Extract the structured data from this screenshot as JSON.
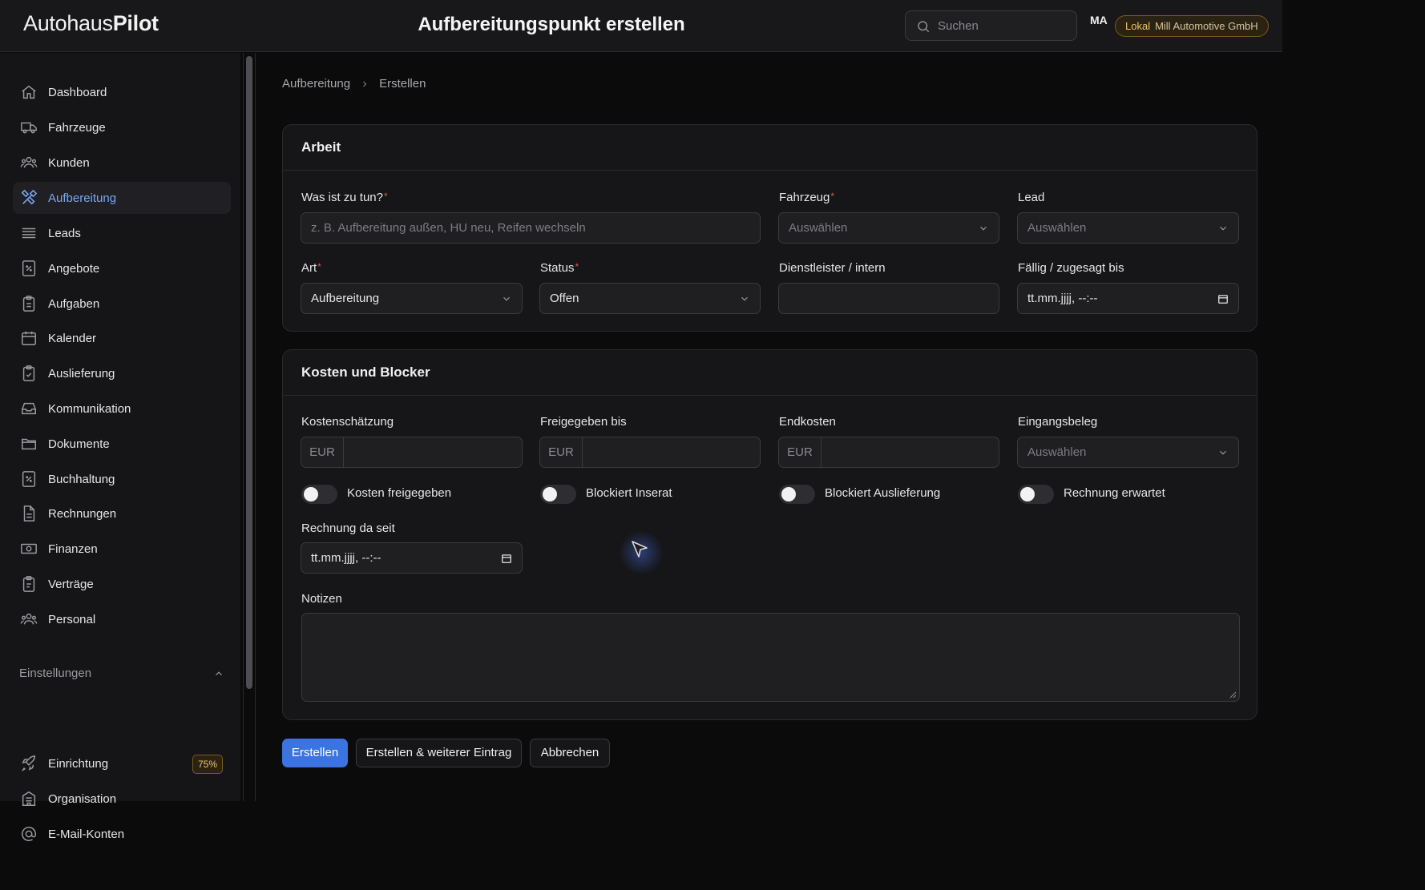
{
  "header": {
    "logo_light": "Autohaus",
    "logo_bold": "Pilot",
    "page_title": "Aufbereitungspunkt erstellen",
    "search_placeholder": "Suchen",
    "avatar_initials": "MA",
    "org_env": "Lokal",
    "org_name": "Mill Automotive GmbH"
  },
  "sidebar": {
    "items": [
      {
        "label": "Dashboard",
        "icon": "home-icon"
      },
      {
        "label": "Fahrzeuge",
        "icon": "truck-icon"
      },
      {
        "label": "Kunden",
        "icon": "users-icon"
      },
      {
        "label": "Aufbereitung",
        "icon": "tools-icon",
        "active": true
      },
      {
        "label": "Leads",
        "icon": "stack-icon"
      },
      {
        "label": "Angebote",
        "icon": "percent-doc-icon"
      },
      {
        "label": "Aufgaben",
        "icon": "clipboard-icon"
      },
      {
        "label": "Kalender",
        "icon": "calendar-icon"
      },
      {
        "label": "Auslieferung",
        "icon": "clipboard-check-icon"
      },
      {
        "label": "Kommunikation",
        "icon": "inbox-icon"
      },
      {
        "label": "Dokumente",
        "icon": "folder-icon"
      },
      {
        "label": "Buchhaltung",
        "icon": "percent-doc-icon"
      },
      {
        "label": "Rechnungen",
        "icon": "document-icon"
      },
      {
        "label": "Finanzen",
        "icon": "banknote-icon"
      },
      {
        "label": "Verträge",
        "icon": "clipboard-copy-icon"
      },
      {
        "label": "Personal",
        "icon": "users-icon"
      }
    ],
    "settings_section": "Einstellungen",
    "settings_items": [
      {
        "label": "Einrichtung",
        "icon": "rocket-icon",
        "badge": "75%"
      },
      {
        "label": "Organisation",
        "icon": "building-icon"
      },
      {
        "label": "E-Mail-Konten",
        "icon": "at-icon"
      }
    ]
  },
  "breadcrumb": {
    "parent": "Aufbereitung",
    "current": "Erstellen"
  },
  "arbeit": {
    "title": "Arbeit",
    "task_label": "Was ist zu tun?",
    "task_placeholder": "z. B. Aufbereitung außen, HU neu, Reifen wechseln",
    "vehicle_label": "Fahrzeug",
    "vehicle_value": "Auswählen",
    "lead_label": "Lead",
    "lead_value": "Auswählen",
    "type_label": "Art",
    "type_value": "Aufbereitung",
    "status_label": "Status",
    "status_value": "Offen",
    "provider_label": "Dienstleister / intern",
    "provider_value": "",
    "due_label": "Fällig / zugesagt bis",
    "due_value": "tt.mm.jjjj, --:--",
    "required_mark": "*"
  },
  "kosten": {
    "title": "Kosten und Blocker",
    "estimate_label": "Kostenschätzung",
    "released_label": "Freigegeben bis",
    "final_label": "Endkosten",
    "receipt_label": "Eingangsbeleg",
    "receipt_value": "Auswählen",
    "currency": "EUR",
    "toggle_cost_released": "Kosten freigegeben",
    "toggle_blocks_listing": "Blockiert Inserat",
    "toggle_blocks_delivery": "Blockiert Auslieferung",
    "toggle_invoice_expected": "Rechnung erwartet",
    "invoice_since_label": "Rechnung da seit",
    "invoice_since_value": "tt.mm.jjjj, --:--",
    "notes_label": "Notizen"
  },
  "actions": {
    "create": "Erstellen",
    "create_another": "Erstellen & weiterer Eintrag",
    "cancel": "Abbrechen"
  }
}
